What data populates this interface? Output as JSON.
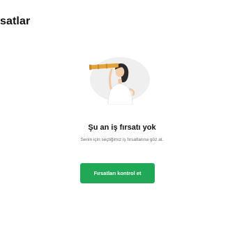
{
  "header": {
    "title": "satlar"
  },
  "empty_state": {
    "illustration": "woman-looking-through-telescope",
    "title": "Şu an iş fırsatı yok",
    "subtitle": "Senin için seçtiğimiz iş fırsatlarına göz at.",
    "button_label": "Fırsatları kontrol et"
  },
  "colors": {
    "accent": "#21a857",
    "background": "#ffffff",
    "illustration_bg": "#f0f0f0",
    "telescope": "#e3a33a"
  }
}
